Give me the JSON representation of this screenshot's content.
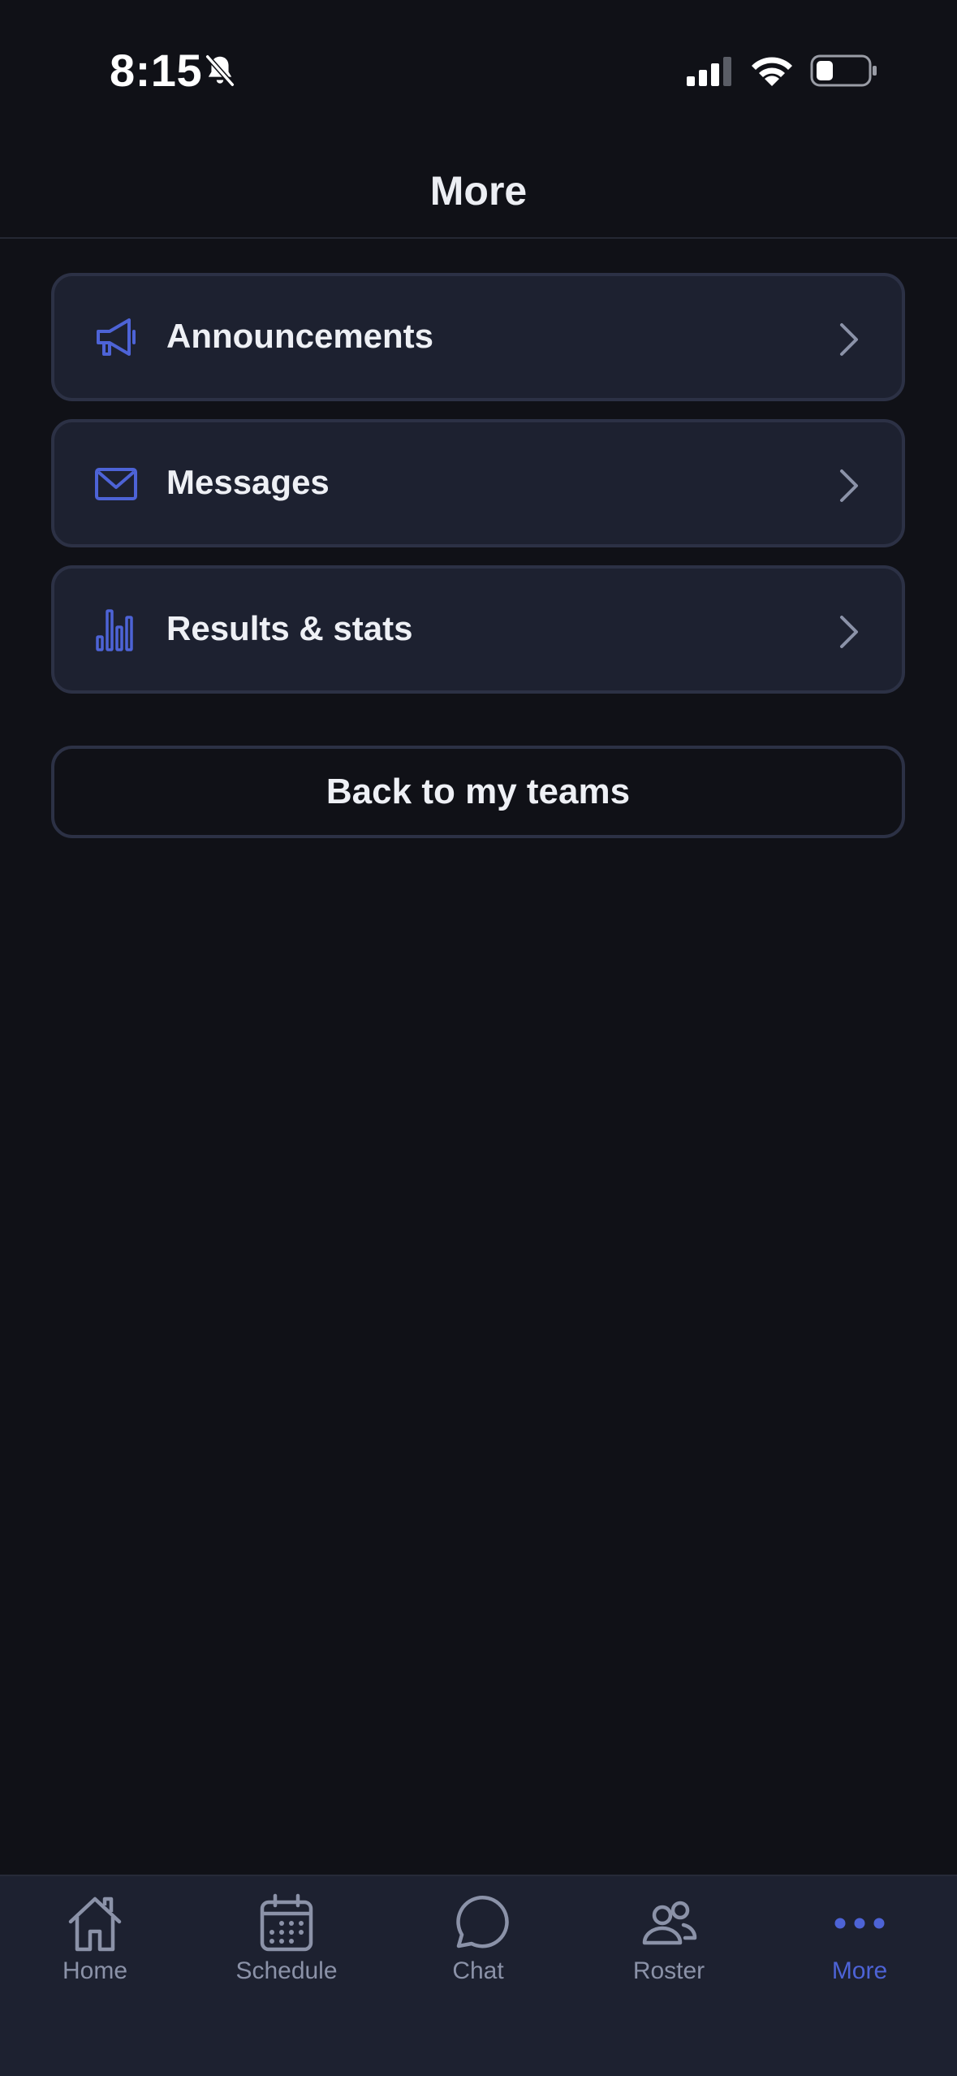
{
  "status_bar": {
    "time": "8:15"
  },
  "header": {
    "title": "More"
  },
  "menu": [
    {
      "label": "Announcements",
      "icon": "megaphone-icon"
    },
    {
      "label": "Messages",
      "icon": "envelope-icon"
    },
    {
      "label": "Results & stats",
      "icon": "bar-chart-icon"
    }
  ],
  "back_button": {
    "label": "Back to my teams"
  },
  "tabs": [
    {
      "label": "Home",
      "icon": "home-icon"
    },
    {
      "label": "Schedule",
      "icon": "calendar-icon"
    },
    {
      "label": "Chat",
      "icon": "chat-bubble-icon"
    },
    {
      "label": "Roster",
      "icon": "people-icon"
    },
    {
      "label": "More",
      "icon": "more-dots-icon",
      "active": true
    }
  ],
  "colors": {
    "background": "#101117",
    "card": "#1d2130",
    "card_border": "#2c3145",
    "accent": "#4d63d6",
    "muted": "#8b92a8"
  }
}
